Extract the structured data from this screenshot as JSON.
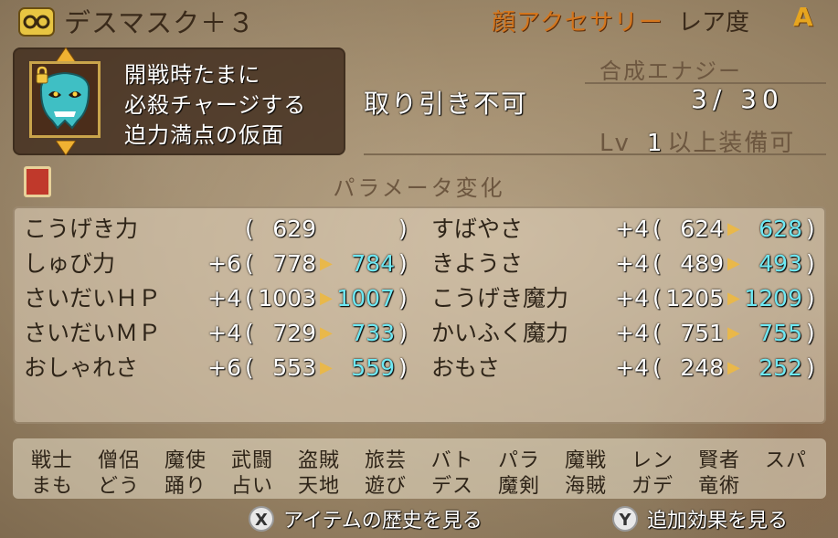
{
  "header": {
    "item_name": "デスマスク＋３",
    "category": "顔アクセサリー",
    "rarity_label": "レア度",
    "rarity_grade": "A"
  },
  "description": [
    "開戦時たまに",
    "必殺チャージする",
    "迫力満点の仮面"
  ],
  "trade_status": "取り引き不可",
  "synthesis": {
    "label": "合成エナジー",
    "current": "3",
    "max": "30",
    "value_text": "3/ 30"
  },
  "level_requirement": {
    "prefix": "Lv",
    "level": "1",
    "suffix": "以上装備可"
  },
  "params_title": "パラメータ変化",
  "stats_left": [
    {
      "name": "こうげき力",
      "delta": "",
      "old": "629",
      "new": ""
    },
    {
      "name": "しゅび力",
      "delta": "+6",
      "old": "778",
      "new": "784"
    },
    {
      "name": "さいだいＨＰ",
      "delta": "+4",
      "old": "1003",
      "new": "1007"
    },
    {
      "name": "さいだいＭＰ",
      "delta": "+4",
      "old": "729",
      "new": "733"
    },
    {
      "name": "おしゃれさ",
      "delta": "+6",
      "old": "553",
      "new": "559"
    }
  ],
  "stats_right": [
    {
      "name": "すばやさ",
      "delta": "+4",
      "old": "624",
      "new": "628"
    },
    {
      "name": "きようさ",
      "delta": "+4",
      "old": "489",
      "new": "493"
    },
    {
      "name": "こうげき魔力",
      "delta": "+4",
      "old": "1205",
      "new": "1209"
    },
    {
      "name": "かいふく魔力",
      "delta": "+4",
      "old": "751",
      "new": "755"
    },
    {
      "name": "おもさ",
      "delta": "+4",
      "old": "248",
      "new": "252"
    }
  ],
  "jobs_row1": [
    "戦士",
    "僧侶",
    "魔使",
    "武闘",
    "盗賊",
    "旅芸",
    "バト",
    "パラ",
    "魔戦",
    "レン",
    "賢者",
    "スパ"
  ],
  "jobs_row2": [
    "まも",
    "どう",
    "踊り",
    "占い",
    "天地",
    "遊び",
    "デス",
    "魔剣",
    "海賊",
    "ガデ",
    "竜術"
  ],
  "footer": {
    "x_button": "X",
    "x_label": "アイテムの歴史を見る",
    "y_button": "Y",
    "y_label": "追加効果を見る"
  },
  "colors": {
    "category": "#d4761d",
    "rarity_grade": "#e6a51f",
    "new_value": "#6fe8f3",
    "arrow": "#e9b84a"
  },
  "icons": [
    "glasses-icon",
    "lock-icon",
    "mask-icon",
    "book-icon",
    "arrow-up-icon",
    "arrow-down-icon"
  ]
}
